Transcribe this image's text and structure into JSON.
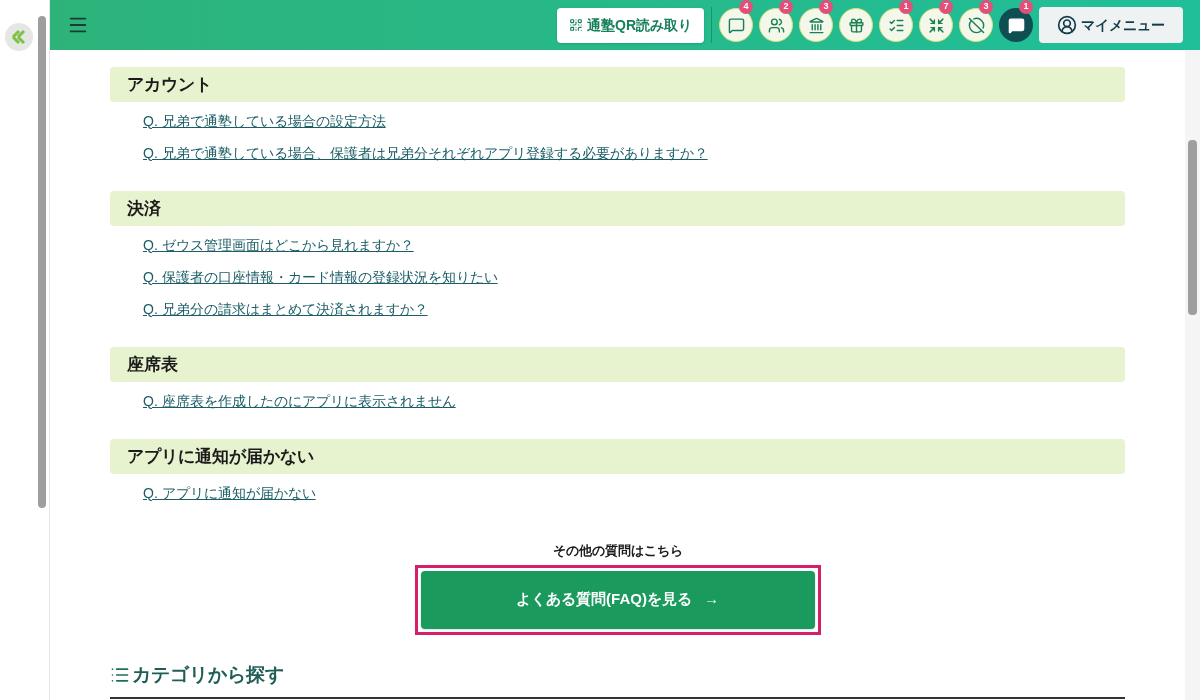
{
  "header": {
    "qr_button": "通塾QR読み取り",
    "icon_buttons": [
      {
        "kind": "message",
        "badge": "4",
        "selected": false
      },
      {
        "kind": "group",
        "badge": "2",
        "selected": false
      },
      {
        "kind": "bank",
        "badge": "3",
        "selected": false
      },
      {
        "kind": "gift",
        "selected": false
      },
      {
        "kind": "checklist",
        "badge": "1",
        "selected": false
      },
      {
        "kind": "arrows",
        "badge": "7",
        "selected": false
      },
      {
        "kind": "off",
        "badge": "3",
        "selected": false
      },
      {
        "kind": "chat",
        "badge": "1",
        "selected": true
      }
    ],
    "my_menu": "マイメニュー"
  },
  "sections": [
    {
      "title": "アカウント",
      "links": [
        "Q. 兄弟で通塾している場合の設定方法",
        "Q. 兄弟で通塾している場合、保護者は兄弟分それぞれアプリ登録する必要がありますか？"
      ]
    },
    {
      "title": "決済",
      "links": [
        "Q. ゼウス管理画面はどこから見れますか？",
        "Q. 保護者の口座情報・カード情報の登録状況を知りたい",
        "Q. 兄弟分の請求はまとめて決済されますか？"
      ]
    },
    {
      "title": "座席表",
      "links": [
        "Q. 座席表を作成したのにアプリに表示されません"
      ]
    },
    {
      "title": "アプリに通知が届かない",
      "links": [
        "Q. アプリに通知が届かない"
      ]
    }
  ],
  "more": {
    "label": "その他の質問はこちら",
    "button": "よくある質問(FAQ)を見る",
    "arrow": "→"
  },
  "category_heading": "カテゴリから探す"
}
